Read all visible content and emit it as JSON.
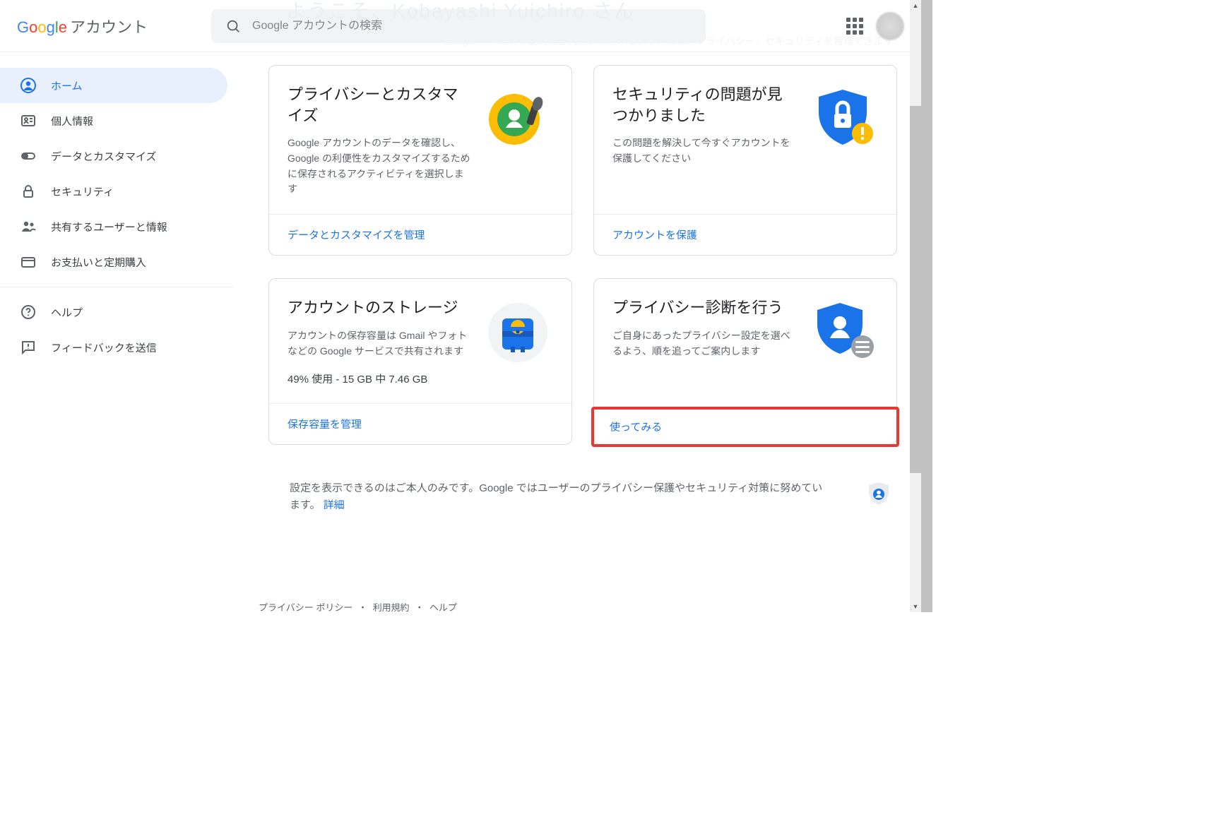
{
  "header": {
    "account_label": "アカウント",
    "search_placeholder": "Google アカウントの検索",
    "ghost_banner": "ようこそ、Kobayashi Yuichiro さん",
    "ghost_sub": "Google サービスを便利にご利用いただけるよう、情報、プライバシー、セキュリティを管理できます"
  },
  "sidebar": {
    "items": [
      {
        "label": "ホーム"
      },
      {
        "label": "個人情報"
      },
      {
        "label": "データとカスタマイズ"
      },
      {
        "label": "セキュリティ"
      },
      {
        "label": "共有するユーザーと情報"
      },
      {
        "label": "お支払いと定期購入"
      }
    ],
    "help": "ヘルプ",
    "feedback": "フィードバックを送信"
  },
  "cards": {
    "privacy": {
      "title": "プライバシーとカスタマイズ",
      "desc": "Google アカウントのデータを確認し、Google の利便性をカスタマイズするために保存されるアクティビティを選択します",
      "link": "データとカスタマイズを管理"
    },
    "security": {
      "title": "セキュリティの問題が見つかりました",
      "desc": "この問題を解決して今すぐアカウントを保護してください",
      "link": "アカウントを保護"
    },
    "storage": {
      "title": "アカウントのストレージ",
      "desc": "アカウントの保存容量は Gmail やフォトなどの Google サービスで共有されます",
      "usage": "49% 使用 - 15 GB 中 7.46 GB",
      "link": "保存容量を管理"
    },
    "checkup": {
      "title": "プライバシー診断を行う",
      "desc": "ご自身にあったプライバシー設定を選べるよう、順を追ってご案内します",
      "link": "使ってみる"
    }
  },
  "footnote": {
    "text": "設定を表示できるのはご本人のみです。Google ではユーザーのプライバシー保護やセキュリティ対策に努めています。 ",
    "link": "詳細"
  },
  "bottom": {
    "privacy": "プライバシー ポリシー",
    "terms": "利用規約",
    "help": "ヘルプ"
  }
}
